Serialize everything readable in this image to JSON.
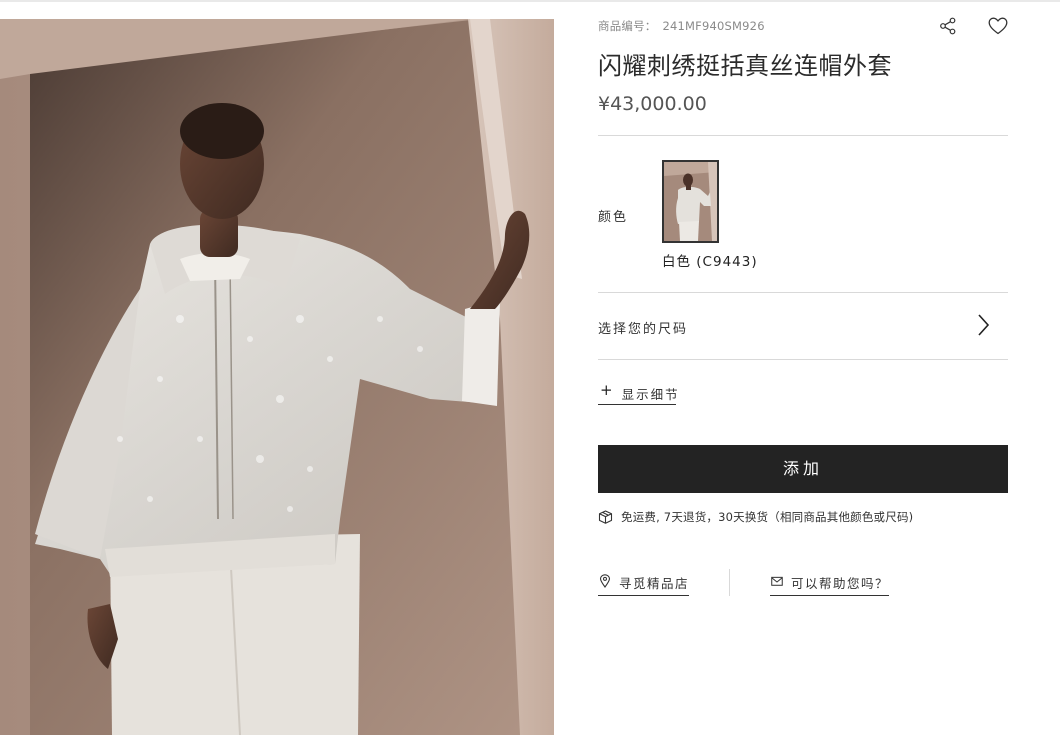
{
  "product": {
    "sku_label": "商品编号：",
    "sku_value": "241MF940SM926",
    "title": "闪耀刺绣挺括真丝连帽外套",
    "price": "¥43,000.00"
  },
  "icons": {
    "share": "share-icon",
    "wishlist": "heart-icon",
    "size_chevron": "chevron-right-icon",
    "details_plus": "plus-icon",
    "shipping": "box-icon",
    "store": "location-pin-icon",
    "help": "mail-icon"
  },
  "color": {
    "label": "颜色",
    "selected_name": "白色 (C9443)"
  },
  "size": {
    "label": "选择您的尺码"
  },
  "details": {
    "toggle_label": "显示细节"
  },
  "cart": {
    "add_label": "添加"
  },
  "shipping": {
    "text": "免运费, 7天退货，30天换货（相同商品其他颜色或尺码)"
  },
  "links": {
    "store_label": "寻觅精品店",
    "help_label": "可以帮助您吗？"
  },
  "colors": {
    "button_bg": "#232323",
    "divider": "#d9d9d9",
    "text_muted": "#8a8a8a"
  }
}
